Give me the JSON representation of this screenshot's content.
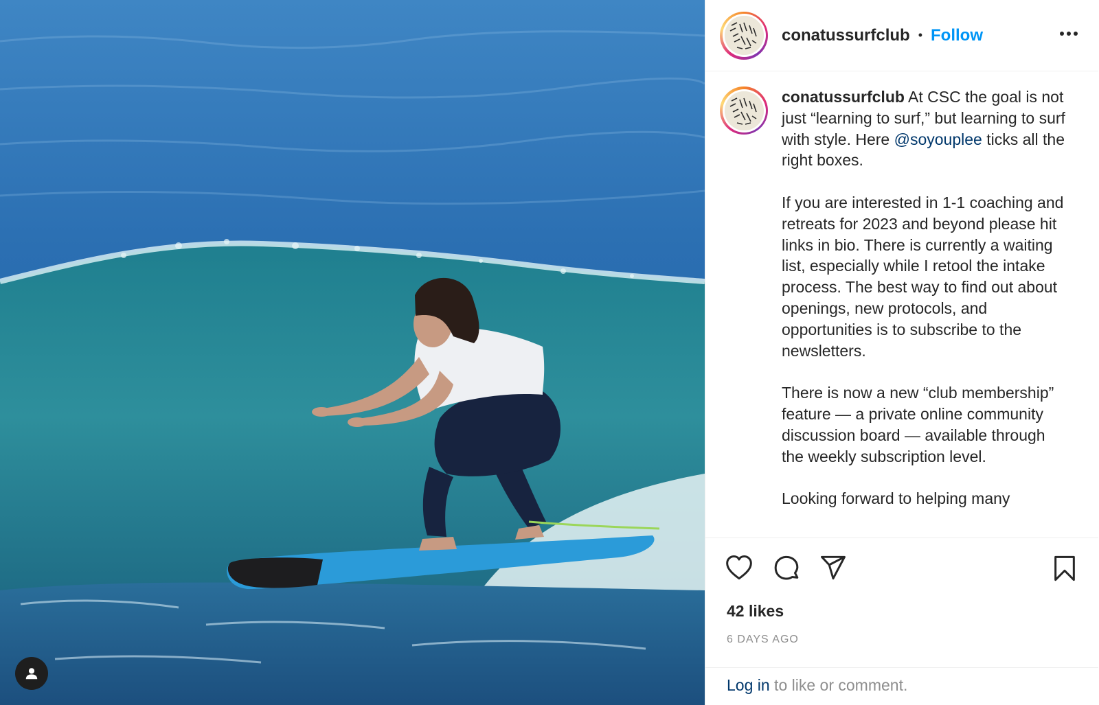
{
  "post": {
    "username": "conatussurfclub",
    "separator": "•",
    "follow_label": "Follow",
    "more_icon": "more-horizontal-icon",
    "media_alt": "Surfer riding a wave on a blue longboard",
    "user_tag_icon": "user-tag-icon"
  },
  "caption": {
    "username": "conatussurfclub",
    "p1_text_a": "At CSC the goal is not just “learning to surf,” but learning to surf with style. Here ",
    "mention": "@soyouplee",
    "p1_text_b": " ticks all the right boxes.",
    "p2": "If you are interested in 1-1 coaching and retreats for 2023 and beyond please hit links in bio. There is currently a waiting list, especially while I retool the intake process. The best way to find out about openings, new protocols, and opportunities is to subscribe to the newsletters.",
    "p3": "There is now a new “club membership” feature — a private online community discussion board — available through the weekly subscription level.",
    "p4": "Looking forward to helping many"
  },
  "actions": {
    "like_icon": "heart-icon",
    "comment_icon": "comment-icon",
    "share_icon": "share-icon",
    "save_icon": "bookmark-icon"
  },
  "stats": {
    "likes": "42 likes",
    "time_ago": "6 DAYS AGO"
  },
  "login": {
    "link": "Log in",
    "rest": " to like or comment."
  },
  "colors": {
    "accent": "#0095f6",
    "mention": "#00376b",
    "muted": "#8e8e8e",
    "text": "#262626"
  }
}
